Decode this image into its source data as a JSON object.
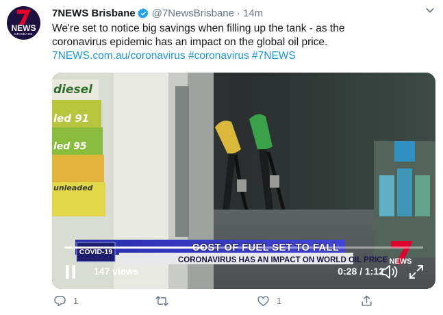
{
  "tweet": {
    "avatar_text": "NEWS",
    "avatar_city": "BRISBANE",
    "display_name": "7NEWS Brisbane",
    "handle": "@7NewsBrisbane",
    "separator": "·",
    "time": "14m",
    "text_line1": "We're set to notice big savings when filling up the tank - as the",
    "text_line2": "coronavirus epidemic has an impact on the global oil price.",
    "links": "7NEWS.com.au/coronavirus #coronavirus #7NEWS"
  },
  "video": {
    "headline": "COST OF FUEL SET TO FALL",
    "subheadline": "CORONAVIRUS HAS AN IMPACT ON WORLD OIL PRICE",
    "tag": "COVID-19",
    "logo_text": "NEWS",
    "pump_labels": [
      "diesel",
      "led 91",
      "led 95",
      "unleaded"
    ],
    "views": "147 views",
    "time_display": "0:28 / 1:12",
    "progress": 0.389
  },
  "actions": {
    "reply_count": "1",
    "retweet_count": "",
    "like_count": "1"
  },
  "colors": {
    "link": "#1b95e0",
    "muted": "#657786",
    "verified": "#1da1f2",
    "avatar_bg": "#1c1040",
    "brand_red": "#e4002b"
  },
  "icons": [
    "seven-logo-icon",
    "verified-badge-icon",
    "chevron-down-icon",
    "pause-icon",
    "volume-icon",
    "expand-icon",
    "reply-icon",
    "retweet-icon",
    "like-icon",
    "share-icon"
  ]
}
